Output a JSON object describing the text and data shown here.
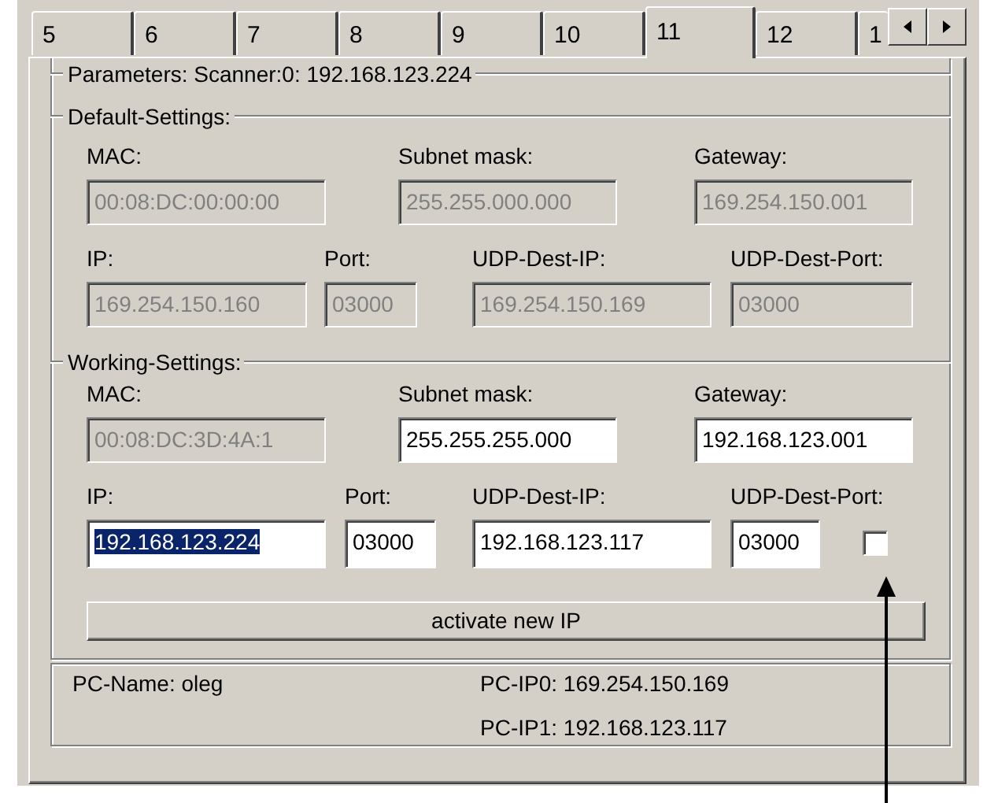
{
  "tabs": [
    {
      "label": "5",
      "selected": false
    },
    {
      "label": "6",
      "selected": false
    },
    {
      "label": "7",
      "selected": false
    },
    {
      "label": "8",
      "selected": false
    },
    {
      "label": "9",
      "selected": false
    },
    {
      "label": "10",
      "selected": false
    },
    {
      "label": "11",
      "selected": true
    },
    {
      "label": "12",
      "selected": false
    },
    {
      "label": "1",
      "selected": false
    }
  ],
  "parameters": {
    "title": "Parameters: Scanner:0: 192.168.123.224",
    "default_settings": {
      "title": "Default-Settings:",
      "line_1": [
        {
          "label": "MAC:",
          "value": "00:08:DC:00:00:00",
          "disabled": true,
          "selected": false
        },
        {
          "label": "Subnet mask:",
          "value": "255.255.000.000",
          "disabled": true,
          "selected": false
        },
        {
          "label": "Gateway:",
          "value": "169.254.150.001",
          "disabled": true,
          "selected": false
        }
      ],
      "line_2": [
        {
          "label": "IP:",
          "value": "169.254.150.160",
          "disabled": true,
          "selected": false
        },
        {
          "label": "Port:",
          "value": "03000",
          "disabled": true,
          "selected": false
        },
        {
          "label": "UDP-Dest-IP:",
          "value": "169.254.150.169",
          "disabled": true,
          "selected": false
        },
        {
          "label": "UDP-Dest-Port:",
          "value": "03000",
          "disabled": true,
          "selected": false
        }
      ]
    },
    "working_settings": {
      "title": "Working-Settings:",
      "line_1": [
        {
          "label": "MAC:",
          "value": "00:08:DC:3D:4A:1",
          "disabled": true,
          "selected": false
        },
        {
          "label": "Subnet mask:",
          "value": "255.255.255.000",
          "disabled": false,
          "selected": false
        },
        {
          "label": "Gateway:",
          "value": "192.168.123.001",
          "disabled": false,
          "selected": false
        }
      ],
      "line_2": [
        {
          "label": "IP:",
          "value": "192.168.123.224",
          "disabled": false,
          "selected": true
        },
        {
          "label": "Port:",
          "value": "03000",
          "disabled": false,
          "selected": false
        },
        {
          "label": "UDP-Dest-IP:",
          "value": "192.168.123.117",
          "disabled": false,
          "selected": false
        },
        {
          "label": "UDP-Dest-Port:",
          "value": "03000",
          "disabled": false,
          "selected": false
        }
      ],
      "checkbox": {
        "checked": false
      },
      "button": "activate new IP"
    }
  },
  "pc_info": {
    "pc_name": "PC-Name: oleg",
    "pc_ip0": "PC-IP0: 169.254.150.169",
    "pc_ip1": "PC-IP1: 192.168.123.117"
  }
}
